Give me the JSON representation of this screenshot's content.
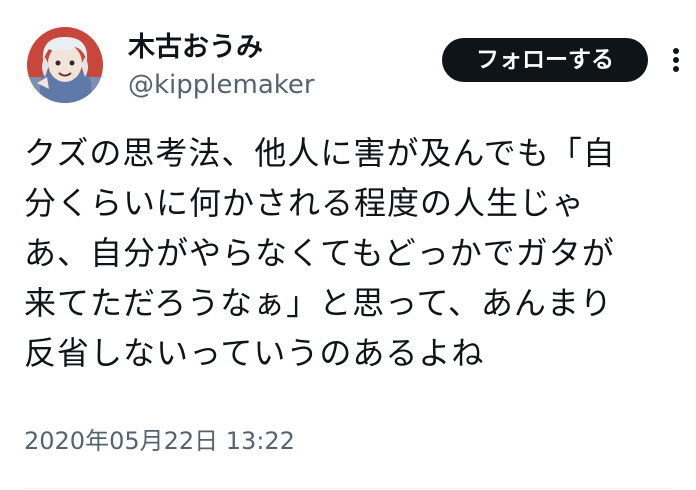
{
  "author": {
    "display_name": "木古おうみ",
    "handle": "@kipplemaker",
    "avatar_icon": "anime-character-avatar-icon"
  },
  "follow_button": {
    "label": "フォローする"
  },
  "more_menu": {
    "icon": "more-vertical-icon"
  },
  "tweet": {
    "lines": [
      "クズの思考法、他人に害が及んでも「自",
      "分くらいに何かされる程度の人生じゃ",
      "あ、自分がやらなくてもどっかでガタが",
      "来てただろうなぁ」と思って、あんまり",
      "反省しないっていうのあるよね"
    ],
    "timestamp": "2020年05月22日 13:22"
  },
  "colors": {
    "text": "#0f1419",
    "secondary_text": "#536471",
    "follow_button_bg": "#0f1419",
    "divider": "#eff3f4"
  }
}
